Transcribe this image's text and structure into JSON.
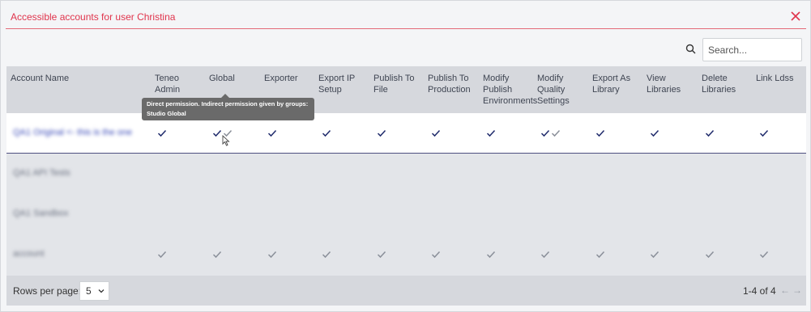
{
  "dialog": {
    "title": "Accessible accounts for user Christina"
  },
  "search": {
    "placeholder": "Search..."
  },
  "table": {
    "columns": [
      {
        "label": "Account Name"
      },
      {
        "label": "Teneo\nAdmin"
      },
      {
        "label": "Global"
      },
      {
        "label": "Exporter"
      },
      {
        "label": "Export IP\nSetup"
      },
      {
        "label": "Publish To\nFile"
      },
      {
        "label": "Publish To\nProduction"
      },
      {
        "label": "Modify\nPublish\nEnvironments"
      },
      {
        "label": "Modify\nQuality\nSettings"
      },
      {
        "label": "Export As\nLibrary"
      },
      {
        "label": "View\nLibraries"
      },
      {
        "label": "Delete\nLibraries"
      },
      {
        "label": "Link Ldss"
      }
    ],
    "rows": [
      {
        "name": "QA1 Original <- this is the one",
        "selected": true,
        "perms": [
          "direct",
          "direct+indirect",
          "direct",
          "direct",
          "direct",
          "direct",
          "direct",
          "direct+indirect",
          "direct",
          "direct",
          "direct",
          "direct"
        ]
      },
      {
        "name": "QA1 API Tests",
        "selected": false,
        "perms": [
          "",
          "",
          "",
          "",
          "",
          "",
          "",
          "",
          "",
          "",
          "",
          ""
        ]
      },
      {
        "name": "QA1 Sandbox",
        "selected": false,
        "perms": [
          "",
          "",
          "",
          "",
          "",
          "",
          "",
          "",
          "",
          "",
          "",
          ""
        ]
      },
      {
        "name": "account",
        "selected": false,
        "perms": [
          "indirect",
          "indirect",
          "indirect",
          "indirect",
          "indirect",
          "indirect",
          "indirect",
          "indirect",
          "indirect",
          "indirect",
          "indirect",
          "indirect"
        ]
      }
    ]
  },
  "tooltip": {
    "line1": "Direct permission. Indirect permission given by groups:",
    "line2": "Studio Global"
  },
  "footer": {
    "rows_per_page_label": "Rows per page:",
    "rows_per_page_value": "5",
    "page_info": "1-4 of 4",
    "prev": "←",
    "next": "→"
  },
  "colors": {
    "accent": "#e0344c",
    "check_direct": "#1f2a6b",
    "check_indirect": "#8a8f99"
  },
  "icons": {
    "close": "close-icon",
    "search": "search-icon",
    "check": "check-icon",
    "chevron": "chevron-down-icon"
  }
}
